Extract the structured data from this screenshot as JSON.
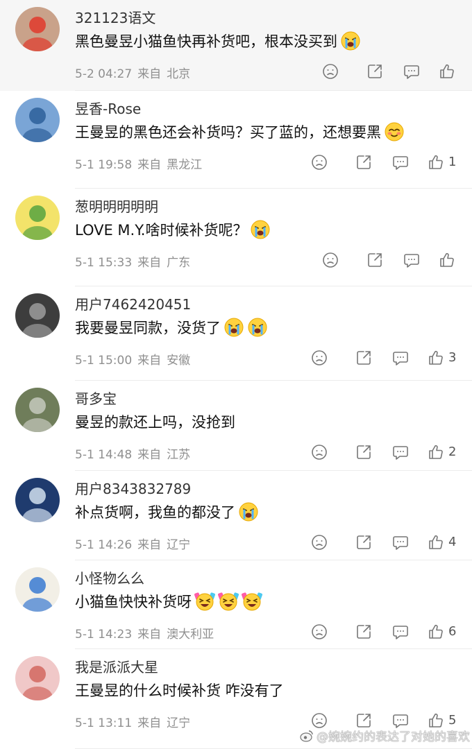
{
  "comments": [
    {
      "username": "321123语文",
      "text": "黑色曼昱小猫鱼快再补货吧，根本没买到",
      "emojis": [
        "crying-face"
      ],
      "time": "5-2 04:27",
      "source_label": "来自",
      "location": "北京",
      "likes": "",
      "highlighted": true
    },
    {
      "username": "昱香-Rose",
      "text": "王曼昱的黑色还会补货吗？买了蓝的，还想要黑",
      "emojis": [
        "shy-smile-face"
      ],
      "time": "5-1 19:58",
      "source_label": "来自",
      "location": "黑龙江",
      "likes": "1",
      "highlighted": false
    },
    {
      "username": "葱明明明明明",
      "text": "LOVE M.Y.啥时候补货呢？",
      "emojis": [
        "crying-face"
      ],
      "time": "5-1 15:33",
      "source_label": "来自",
      "location": "广东",
      "likes": "",
      "highlighted": false
    },
    {
      "username": "用户7462420451",
      "text": "我要曼昱同款，没货了",
      "emojis": [
        "crying-face",
        "crying-face"
      ],
      "time": "5-1 15:00",
      "source_label": "来自",
      "location": "安徽",
      "likes": "3",
      "highlighted": false
    },
    {
      "username": "哥多宝",
      "text": "曼昱的款还上吗，没抢到",
      "emojis": [],
      "time": "5-1 14:48",
      "source_label": "来自",
      "location": "江苏",
      "likes": "2",
      "highlighted": false
    },
    {
      "username": "用户8343832789",
      "text": "补点货啊，我鱼的都没了",
      "emojis": [
        "crying-face"
      ],
      "time": "5-1 14:26",
      "source_label": "来自",
      "location": "辽宁",
      "likes": "4",
      "highlighted": false
    },
    {
      "username": "小怪物么么",
      "text": "小猫鱼快快补货呀",
      "emojis": [
        "cheering-face",
        "cheering-face",
        "cheering-face"
      ],
      "time": "5-1 14:23",
      "source_label": "来自",
      "location": "澳大利亚",
      "likes": "6",
      "highlighted": false
    },
    {
      "username": "我是派派大星",
      "text": "王曼昱的什么时候补货 咋没有了",
      "emojis": [],
      "time": "5-1 13:11",
      "source_label": "来自",
      "location": "辽宁",
      "likes": "5",
      "highlighted": false
    }
  ],
  "watermark": "@婉婉约的表达了对她的喜欢",
  "colors": {
    "meta": "#8f8f8f",
    "icon": "#777777",
    "divider": "#ececec",
    "highlight_bg": "#f6f6f6"
  }
}
